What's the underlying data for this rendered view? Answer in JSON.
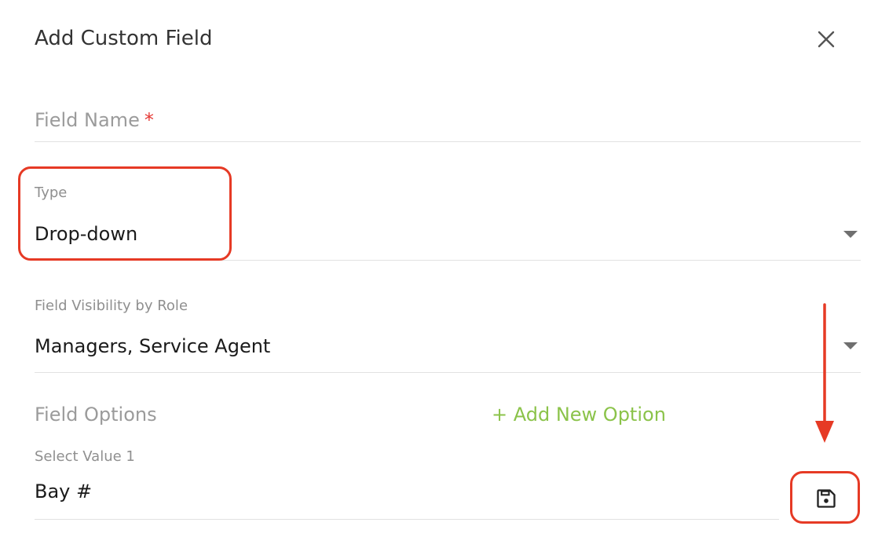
{
  "dialog": {
    "title": "Add Custom Field"
  },
  "fields": {
    "name": {
      "placeholder": "Field Name",
      "required_mark": "*"
    },
    "type": {
      "label": "Type",
      "value": "Drop-down"
    },
    "visibility": {
      "label": "Field Visibility by Role",
      "value": "Managers, Service Agent"
    }
  },
  "options": {
    "section_title": "Field Options",
    "add_label": "+ Add New Option",
    "items": [
      {
        "label": "Select Value 1",
        "value": "Bay #"
      }
    ]
  },
  "icons": {
    "close": "close-icon",
    "dropdown": "caret-down-icon",
    "save": "floppy-disk-icon",
    "annotation": "arrow-down-annotation"
  },
  "colors": {
    "accent_green": "#8bc34a",
    "required_red": "#e53935",
    "annotation_red": "#e63a25"
  }
}
